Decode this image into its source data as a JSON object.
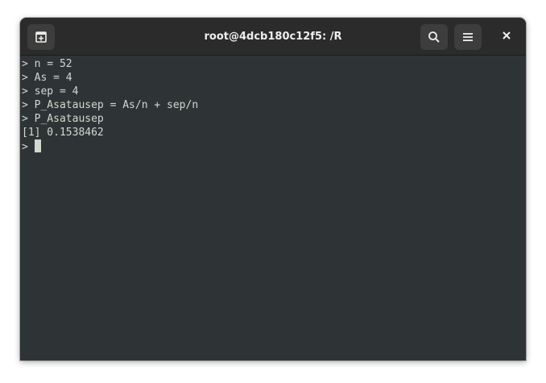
{
  "window": {
    "title": "root@4dcb180c12f5: /R"
  },
  "headerbar": {
    "new_tab_icon": "new-tab-icon",
    "search_icon": "search-icon",
    "menu_icon": "hamburger-menu-icon",
    "close_icon": "close-icon"
  },
  "terminal": {
    "lines": [
      "> n = 52",
      "> As = 4",
      "> sep = 4",
      "> P_Asatausep = As/n + sep/n",
      "> P_Asatausep",
      "[1] 0.1538462"
    ],
    "prompt": "> "
  },
  "colors": {
    "terminal_bg": "#2e3436",
    "terminal_fg": "#d3d7cf",
    "headerbar_bg": "#2b2b2b",
    "button_bg": "#3d3d3d"
  }
}
